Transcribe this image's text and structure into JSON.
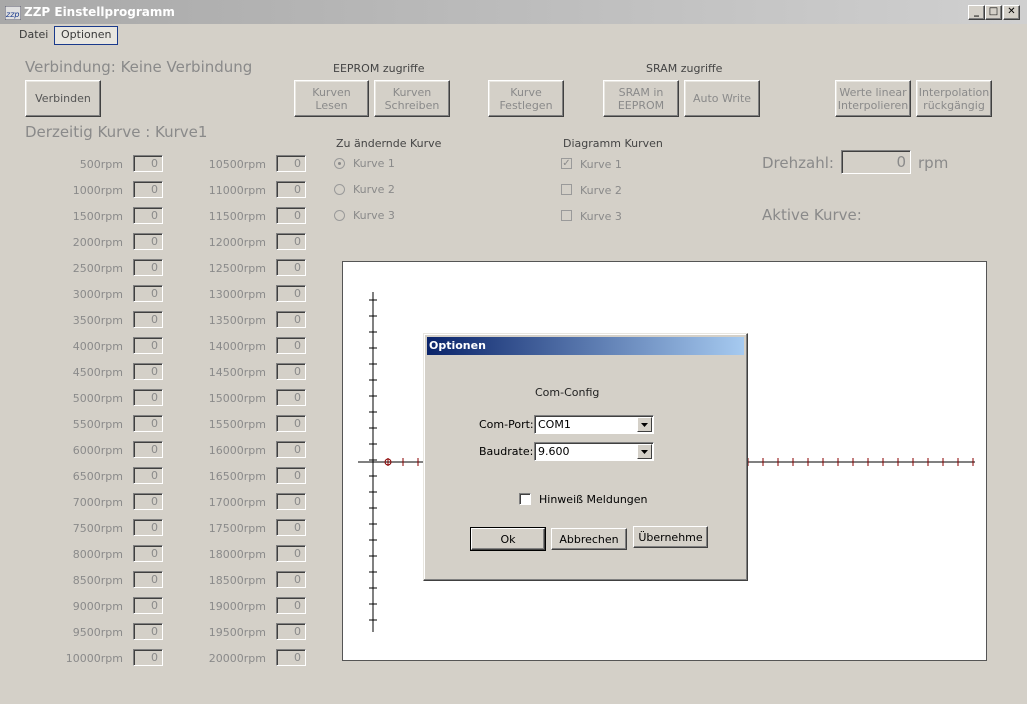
{
  "window": {
    "title": "ZZP Einstellprogramm",
    "icon": "zzp-app-icon"
  },
  "caption_buttons": {
    "minimize": "_",
    "maximize": "□",
    "close": "✕"
  },
  "menu": {
    "items": [
      "Datei",
      "Optionen"
    ],
    "active": "Optionen"
  },
  "connection": {
    "status_text": "Verbindung: Keine Verbindung",
    "connect_label": "Verbinden"
  },
  "current_curve_text": "Derzeitig Kurve : Kurve1",
  "eeprom": {
    "title": "EEPROM zugriffe",
    "read_label_1": "Kurven",
    "read_label_2": "Lesen",
    "write_label_1": "Kurven",
    "write_label_2": "Schreiben"
  },
  "set_curve": {
    "label_1": "Kurve",
    "label_2": "Festlegen"
  },
  "sram": {
    "title": "SRAM zugriffe",
    "to_eeprom_1": "SRAM  in",
    "to_eeprom_2": "EEPROM",
    "auto_write": "Auto Write"
  },
  "interp": {
    "linear_1": "Werte linear",
    "linear_2": "Interpolieren",
    "undo_1": "Interpolation",
    "undo_2": "rückgängig"
  },
  "edit_curve": {
    "title": "Zu ändernde Kurve",
    "options": [
      "Kurve 1",
      "Kurve 2",
      "Kurve 3"
    ],
    "selected": "Kurve 1"
  },
  "diagram_curves": {
    "title": "Diagramm Kurven",
    "options": [
      "Kurve 1",
      "Kurve 2",
      "Kurve 3"
    ],
    "checked": [
      "Kurve 1"
    ]
  },
  "speed": {
    "label": "Drehzahl:",
    "value": "0",
    "unit": "rpm"
  },
  "active_curve_label": "Aktive Kurve:",
  "rpm_left": [
    {
      "label": "500rpm",
      "value": "0"
    },
    {
      "label": "1000rpm",
      "value": "0"
    },
    {
      "label": "1500rpm",
      "value": "0"
    },
    {
      "label": "2000rpm",
      "value": "0"
    },
    {
      "label": "2500rpm",
      "value": "0"
    },
    {
      "label": "3000rpm",
      "value": "0"
    },
    {
      "label": "3500rpm",
      "value": "0"
    },
    {
      "label": "4000rpm",
      "value": "0"
    },
    {
      "label": "4500rpm",
      "value": "0"
    },
    {
      "label": "5000rpm",
      "value": "0"
    },
    {
      "label": "5500rpm",
      "value": "0"
    },
    {
      "label": "6000rpm",
      "value": "0"
    },
    {
      "label": "6500rpm",
      "value": "0"
    },
    {
      "label": "7000rpm",
      "value": "0"
    },
    {
      "label": "7500rpm",
      "value": "0"
    },
    {
      "label": "8000rpm",
      "value": "0"
    },
    {
      "label": "8500rpm",
      "value": "0"
    },
    {
      "label": "9000rpm",
      "value": "0"
    },
    {
      "label": "9500rpm",
      "value": "0"
    },
    {
      "label": "10000rpm",
      "value": "0"
    }
  ],
  "rpm_right": [
    {
      "label": "10500rpm",
      "value": "0"
    },
    {
      "label": "11000rpm",
      "value": "0"
    },
    {
      "label": "11500rpm",
      "value": "0"
    },
    {
      "label": "12000rpm",
      "value": "0"
    },
    {
      "label": "12500rpm",
      "value": "0"
    },
    {
      "label": "13000rpm",
      "value": "0"
    },
    {
      "label": "13500rpm",
      "value": "0"
    },
    {
      "label": "14000rpm",
      "value": "0"
    },
    {
      "label": "14500rpm",
      "value": "0"
    },
    {
      "label": "15000rpm",
      "value": "0"
    },
    {
      "label": "15500rpm",
      "value": "0"
    },
    {
      "label": "16000rpm",
      "value": "0"
    },
    {
      "label": "16500rpm",
      "value": "0"
    },
    {
      "label": "17000rpm",
      "value": "0"
    },
    {
      "label": "17500rpm",
      "value": "0"
    },
    {
      "label": "18000rpm",
      "value": "0"
    },
    {
      "label": "18500rpm",
      "value": "0"
    },
    {
      "label": "19000rpm",
      "value": "0"
    },
    {
      "label": "19500rpm",
      "value": "0"
    },
    {
      "label": "20000rpm",
      "value": "0"
    }
  ],
  "dialog": {
    "title": "Optionen",
    "group_label": "Com-Config",
    "com_port_label": "Com-Port:",
    "com_port_value": "COM1",
    "baudrate_label": "Baudrate:",
    "baudrate_value": "9.600",
    "notify_label": "Hinweiß Meldungen",
    "notify_checked": false,
    "ok_label": "Ok",
    "cancel_label": "Abbrechen",
    "apply_label": "Übernehme"
  },
  "colors": {
    "axis": "#000000",
    "curve_tick": "#8b0000",
    "dialog_title": "#0a246a"
  }
}
